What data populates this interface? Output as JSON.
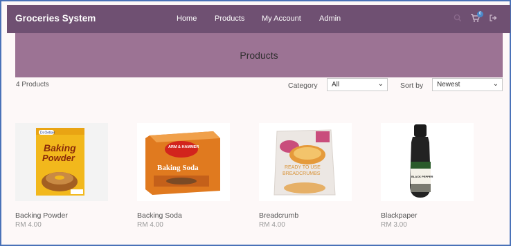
{
  "navbar": {
    "brand": "Groceries System",
    "links": [
      "Home",
      "Products",
      "My Account",
      "Admin"
    ],
    "cart_count": "0",
    "icons": [
      "search-icon",
      "cart-icon",
      "logout-icon"
    ]
  },
  "hero": {
    "title": "Products"
  },
  "toolbar": {
    "count": "4 Products",
    "category_label": "Category",
    "category_value": "All",
    "sort_label": "Sort by",
    "sort_value": "Newest"
  },
  "products": [
    {
      "name": "Backing Powder",
      "price": "RM 4.00",
      "box_text_1": "Baking",
      "box_text_2": "Powder",
      "brand": "Dr.Oetker"
    },
    {
      "name": "Backing Soda",
      "price": "RM 4.00",
      "box_text_1": "Baking Soda",
      "brand": "ARM & HAMMER"
    },
    {
      "name": "Breadcrumb",
      "price": "RM 4.00",
      "box_text_1": "READY TO USE",
      "box_text_2": "BREADCRUMBS"
    },
    {
      "name": "Blackpaper",
      "price": "RM 3.00",
      "box_text_1": "BLACK PEPPER"
    }
  ],
  "colors": {
    "navbar": "#6f5072",
    "hero": "#9c7394",
    "frame_border": "#4a72b8"
  }
}
